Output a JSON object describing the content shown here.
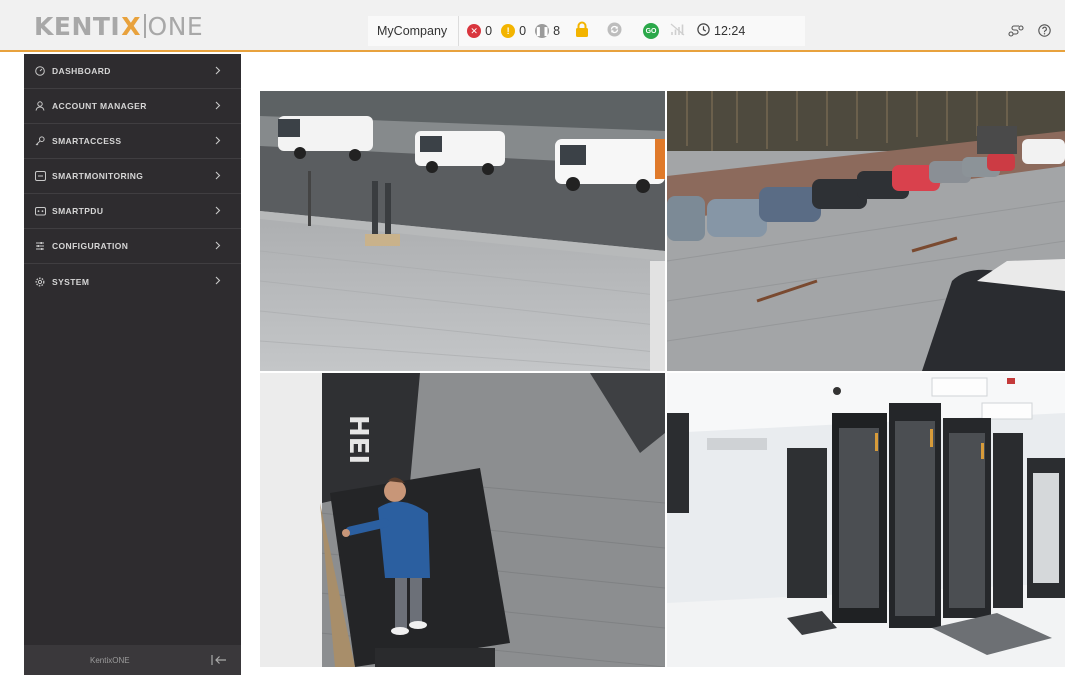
{
  "app": {
    "logo_part1": "KENTI",
    "logo_x": "X",
    "logo_part2": "ONE",
    "accent_color": "#e8a23d"
  },
  "statusbar": {
    "company": "MyCompany",
    "alarm_count": "0",
    "warning_count": "0",
    "info_count": "8",
    "go_label": "GO",
    "time": "12:24",
    "icons": [
      "alarm-icon",
      "warning-icon",
      "info-icon",
      "lock-icon",
      "sync-icon",
      "go-badge",
      "no-signal-icon",
      "clock-icon"
    ]
  },
  "header_right": {
    "icons": [
      "route-icon",
      "help-icon"
    ]
  },
  "sidebar": {
    "items": [
      {
        "label": "DASHBOARD",
        "icon": "dashboard-icon"
      },
      {
        "label": "ACCOUNT MANAGER",
        "icon": "user-icon"
      },
      {
        "label": "SMARTACCESS",
        "icon": "key-icon"
      },
      {
        "label": "SMARTMONITORING",
        "icon": "monitor-icon"
      },
      {
        "label": "SMARTPDU",
        "icon": "pdu-icon"
      },
      {
        "label": "CONFIGURATION",
        "icon": "sliders-icon"
      },
      {
        "label": "SYSTEM",
        "icon": "gear-icon"
      }
    ],
    "footer_label": "KentixONE",
    "colors": {
      "bg": "#2e2c2f",
      "text": "#d6d6d6"
    }
  },
  "cameras": [
    {
      "id": "cam1",
      "scene": "parking-entrance-vans"
    },
    {
      "id": "cam2",
      "scene": "parking-lot-cars"
    },
    {
      "id": "cam3",
      "scene": "person-at-entrance"
    },
    {
      "id": "cam4",
      "scene": "server-room-racks"
    }
  ]
}
